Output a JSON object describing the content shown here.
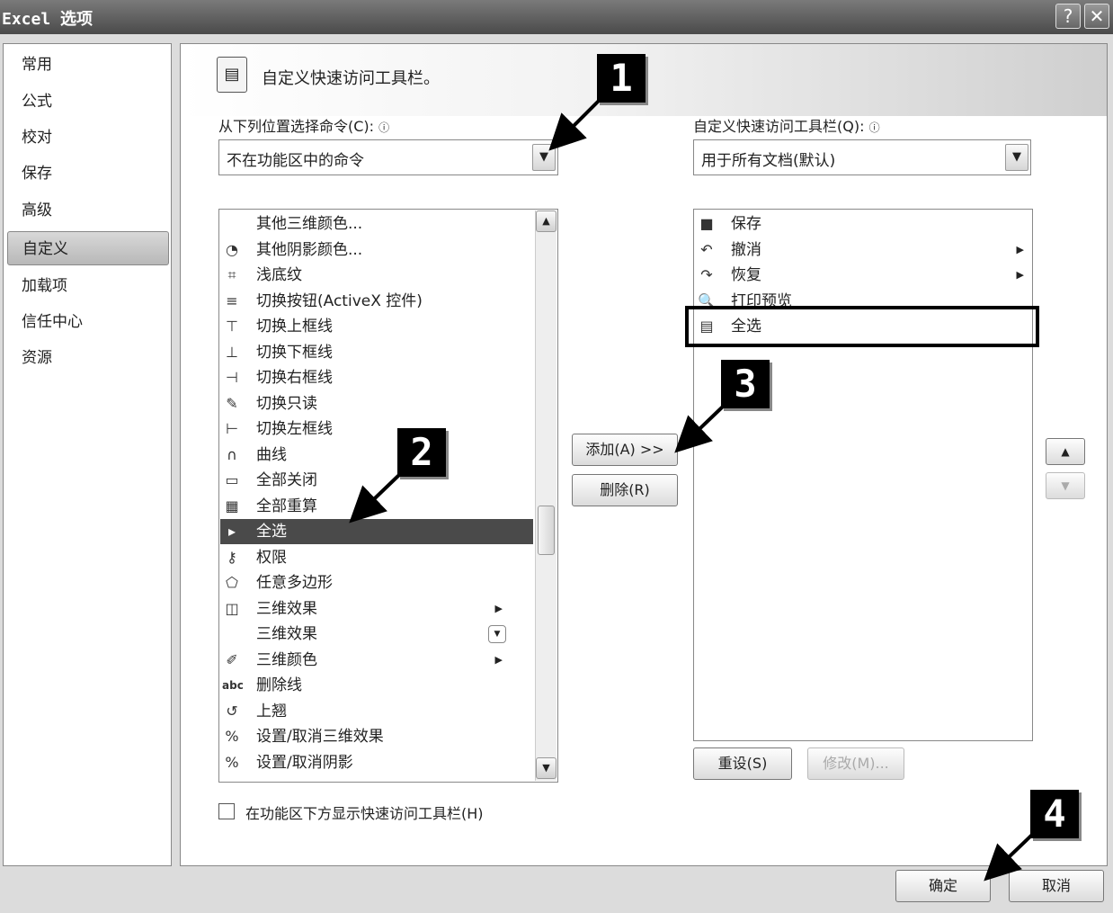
{
  "window": {
    "title": "Excel 选项",
    "help_btn": "?",
    "close_btn": "✕"
  },
  "nav": {
    "items": [
      "常用",
      "公式",
      "校对",
      "保存",
      "高级",
      "自定义",
      "加载项",
      "信任中心",
      "资源"
    ],
    "active": "自定义"
  },
  "header": {
    "title": "自定义快速访问工具栏。"
  },
  "left": {
    "label": "从下列位置选择命令(C):",
    "label_key": "C",
    "combo_value": "不在功能区中的命令",
    "items": [
      {
        "icon": "",
        "label": "其他三维颜色..."
      },
      {
        "icon": "◔",
        "label": "其他阴影颜色..."
      },
      {
        "icon": "⌗",
        "label": "浅底纹"
      },
      {
        "icon": "≡",
        "label": "切换按钮(ActiveX 控件)"
      },
      {
        "icon": "⊤",
        "label": "切换上框线"
      },
      {
        "icon": "⊥",
        "label": "切换下框线"
      },
      {
        "icon": "⊣",
        "label": "切换右框线"
      },
      {
        "icon": "✎",
        "label": "切换只读"
      },
      {
        "icon": "⊢",
        "label": "切换左框线"
      },
      {
        "icon": "∩",
        "label": "曲线"
      },
      {
        "icon": "▭",
        "label": "全部关闭"
      },
      {
        "icon": "▦",
        "label": "全部重算"
      },
      {
        "icon": "▸",
        "label": "全选"
      },
      {
        "icon": "⚷",
        "label": "权限"
      },
      {
        "icon": "⬠",
        "label": "任意多边形"
      },
      {
        "icon": "◫",
        "label": "三维效果"
      },
      {
        "icon": "",
        "label": "三维效果"
      },
      {
        "icon": "✐",
        "label": "三维颜色"
      },
      {
        "icon": "abc",
        "label": "删除线"
      },
      {
        "icon": "↺",
        "label": "上翘"
      },
      {
        "icon": "%",
        "label": "设置/取消三维效果"
      },
      {
        "icon": "%",
        "label": "设置/取消阴影"
      }
    ],
    "selected_index": 12
  },
  "right": {
    "label": "自定义快速访问工具栏(Q):",
    "label_key": "Q",
    "combo_value": "用于所有文档(默认)",
    "items": [
      {
        "icon": "■",
        "label": "保存"
      },
      {
        "icon": "↶",
        "label": "撤消"
      },
      {
        "icon": "↷",
        "label": "恢复"
      },
      {
        "icon": "🔍",
        "label": "打印预览"
      },
      {
        "icon": "▤",
        "label": "全选"
      }
    ]
  },
  "buttons": {
    "add": "添加(A) >>",
    "remove": "删除(R)",
    "reset": "重设(S)",
    "modify": "修改(M)...",
    "ok": "确定",
    "cancel": "取消",
    "move_up": "▲",
    "move_down": "▼"
  },
  "checkbox": {
    "label": "在功能区下方显示快速访问工具栏(H)",
    "checked": false
  },
  "callouts": [
    "1",
    "2",
    "3",
    "4"
  ]
}
